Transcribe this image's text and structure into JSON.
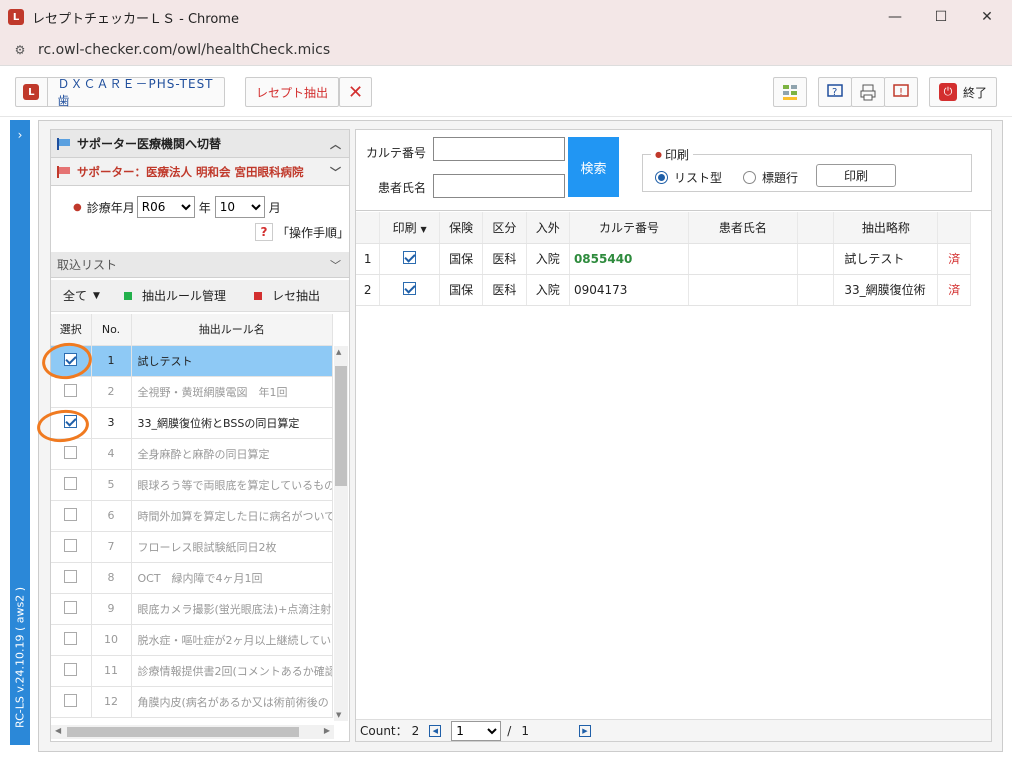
{
  "window": {
    "title": "レセプトチェッカーＬＳ - Chrome",
    "minimize": "—",
    "maximize": "☐",
    "close": "✕",
    "url": "rc.owl-checker.com/owl/healthCheck.mics"
  },
  "toolbar": {
    "facility_label": "ＤＸＣＡＲＥ－PHS-TEST歯",
    "extract_label": "レセプト抽出",
    "exit_label": "終了"
  },
  "sidebar": {
    "version": "RC-LS v.24.10.19 ( aws2 )"
  },
  "left": {
    "switch_header": "サポーター医療機関へ切替",
    "supporter_header": "サポーター：医療法人 明和会 宮田眼科病院",
    "date_label": "診療年月",
    "year_value": "R06",
    "year_unit": "年",
    "month_value": "10",
    "month_unit": "月",
    "help_label": "「操作手順」",
    "import_list": "取込リスト",
    "all_label": "全て",
    "rule_manage": "抽出ルール管理",
    "rece_extract": "レセ抽出",
    "col_select": "選択",
    "col_no": "No.",
    "col_rule": "抽出ルール名",
    "rules": [
      {
        "no": "1",
        "name": "試しテスト",
        "checked": true,
        "selected": true
      },
      {
        "no": "2",
        "name": "全視野・黄斑網膜電図　年1回",
        "checked": false
      },
      {
        "no": "3",
        "name": "33_網膜復位術とBSSの同日算定",
        "checked": true
      },
      {
        "no": "4",
        "name": "全身麻酔と麻酔の同日算定",
        "checked": false
      },
      {
        "no": "5",
        "name": "眼球ろう等で両眼底を算定しているもの",
        "checked": false
      },
      {
        "no": "6",
        "name": "時間外加算を算定した日に病名がついて",
        "checked": false
      },
      {
        "no": "7",
        "name": "フローレス眼試験紙同日2枚",
        "checked": false
      },
      {
        "no": "8",
        "name": "OCT　緑内障で4ヶ月1回",
        "checked": false
      },
      {
        "no": "9",
        "name": "眼底カメラ撮影(蛍光眼底法)+点滴注射",
        "checked": false
      },
      {
        "no": "10",
        "name": "脱水症・嘔吐症が2ヶ月以上継続してい",
        "checked": false
      },
      {
        "no": "11",
        "name": "診療情報提供書2回(コメントあるか確認",
        "checked": false
      },
      {
        "no": "12",
        "name": "角膜内皮(病名があるか又は術前術後の",
        "checked": false
      }
    ]
  },
  "right": {
    "karte_label": "カルテ番号",
    "karte_value": "",
    "patient_label": "患者氏名",
    "patient_value": "",
    "search_label": "検索",
    "print_group": "印刷",
    "radio_list": "リスト型",
    "radio_title": "標題行",
    "print_button": "印刷",
    "headers": [
      "印刷",
      "保険",
      "区分",
      "入外",
      "カルテ番号",
      "患者氏名",
      "抽出略称"
    ],
    "rows": [
      {
        "no": "1",
        "insurance": "国保",
        "category": "医科",
        "inout": "入院",
        "karte": "0855440",
        "name": "",
        "abbr": "試しテスト",
        "done": "済"
      },
      {
        "no": "2",
        "insurance": "国保",
        "category": "医科",
        "inout": "入院",
        "karte": "0904173",
        "name": "",
        "abbr": "33_網膜復位術",
        "done": "済"
      }
    ],
    "count_label": "Count：",
    "count_value": "2",
    "page_value": "1",
    "page_sep": "/",
    "page_total": "1"
  },
  "colors": {
    "accent_blue": "#2b88d8",
    "search_button": "#2196f3",
    "supporter_red": "#c0392b",
    "karte_green": "#2e8b3d",
    "done_red": "#d32f2f",
    "annotation_orange": "#f07a20"
  }
}
